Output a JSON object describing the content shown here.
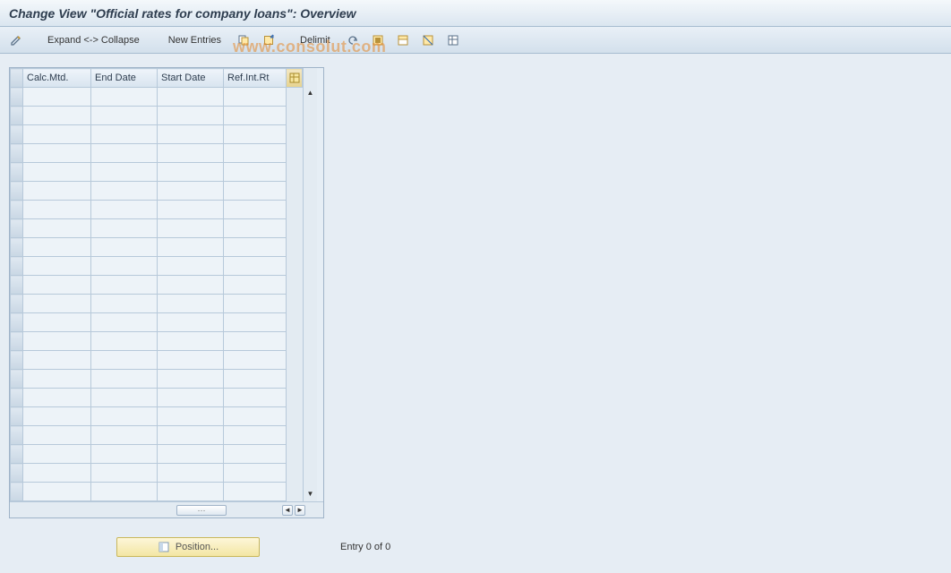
{
  "title": "Change View \"Official rates for company loans\": Overview",
  "watermark": "www.consolut.com",
  "toolbar": {
    "expand_collapse": "Expand <-> Collapse",
    "new_entries": "New Entries",
    "delimit": "Delimit"
  },
  "table": {
    "columns": [
      "Calc.Mtd.",
      "End Date",
      "Start Date",
      "Ref.Int.Rt"
    ],
    "visible_row_count": 22,
    "rows": []
  },
  "footer": {
    "position_label": "Position...",
    "entry_text": "Entry 0 of 0"
  }
}
